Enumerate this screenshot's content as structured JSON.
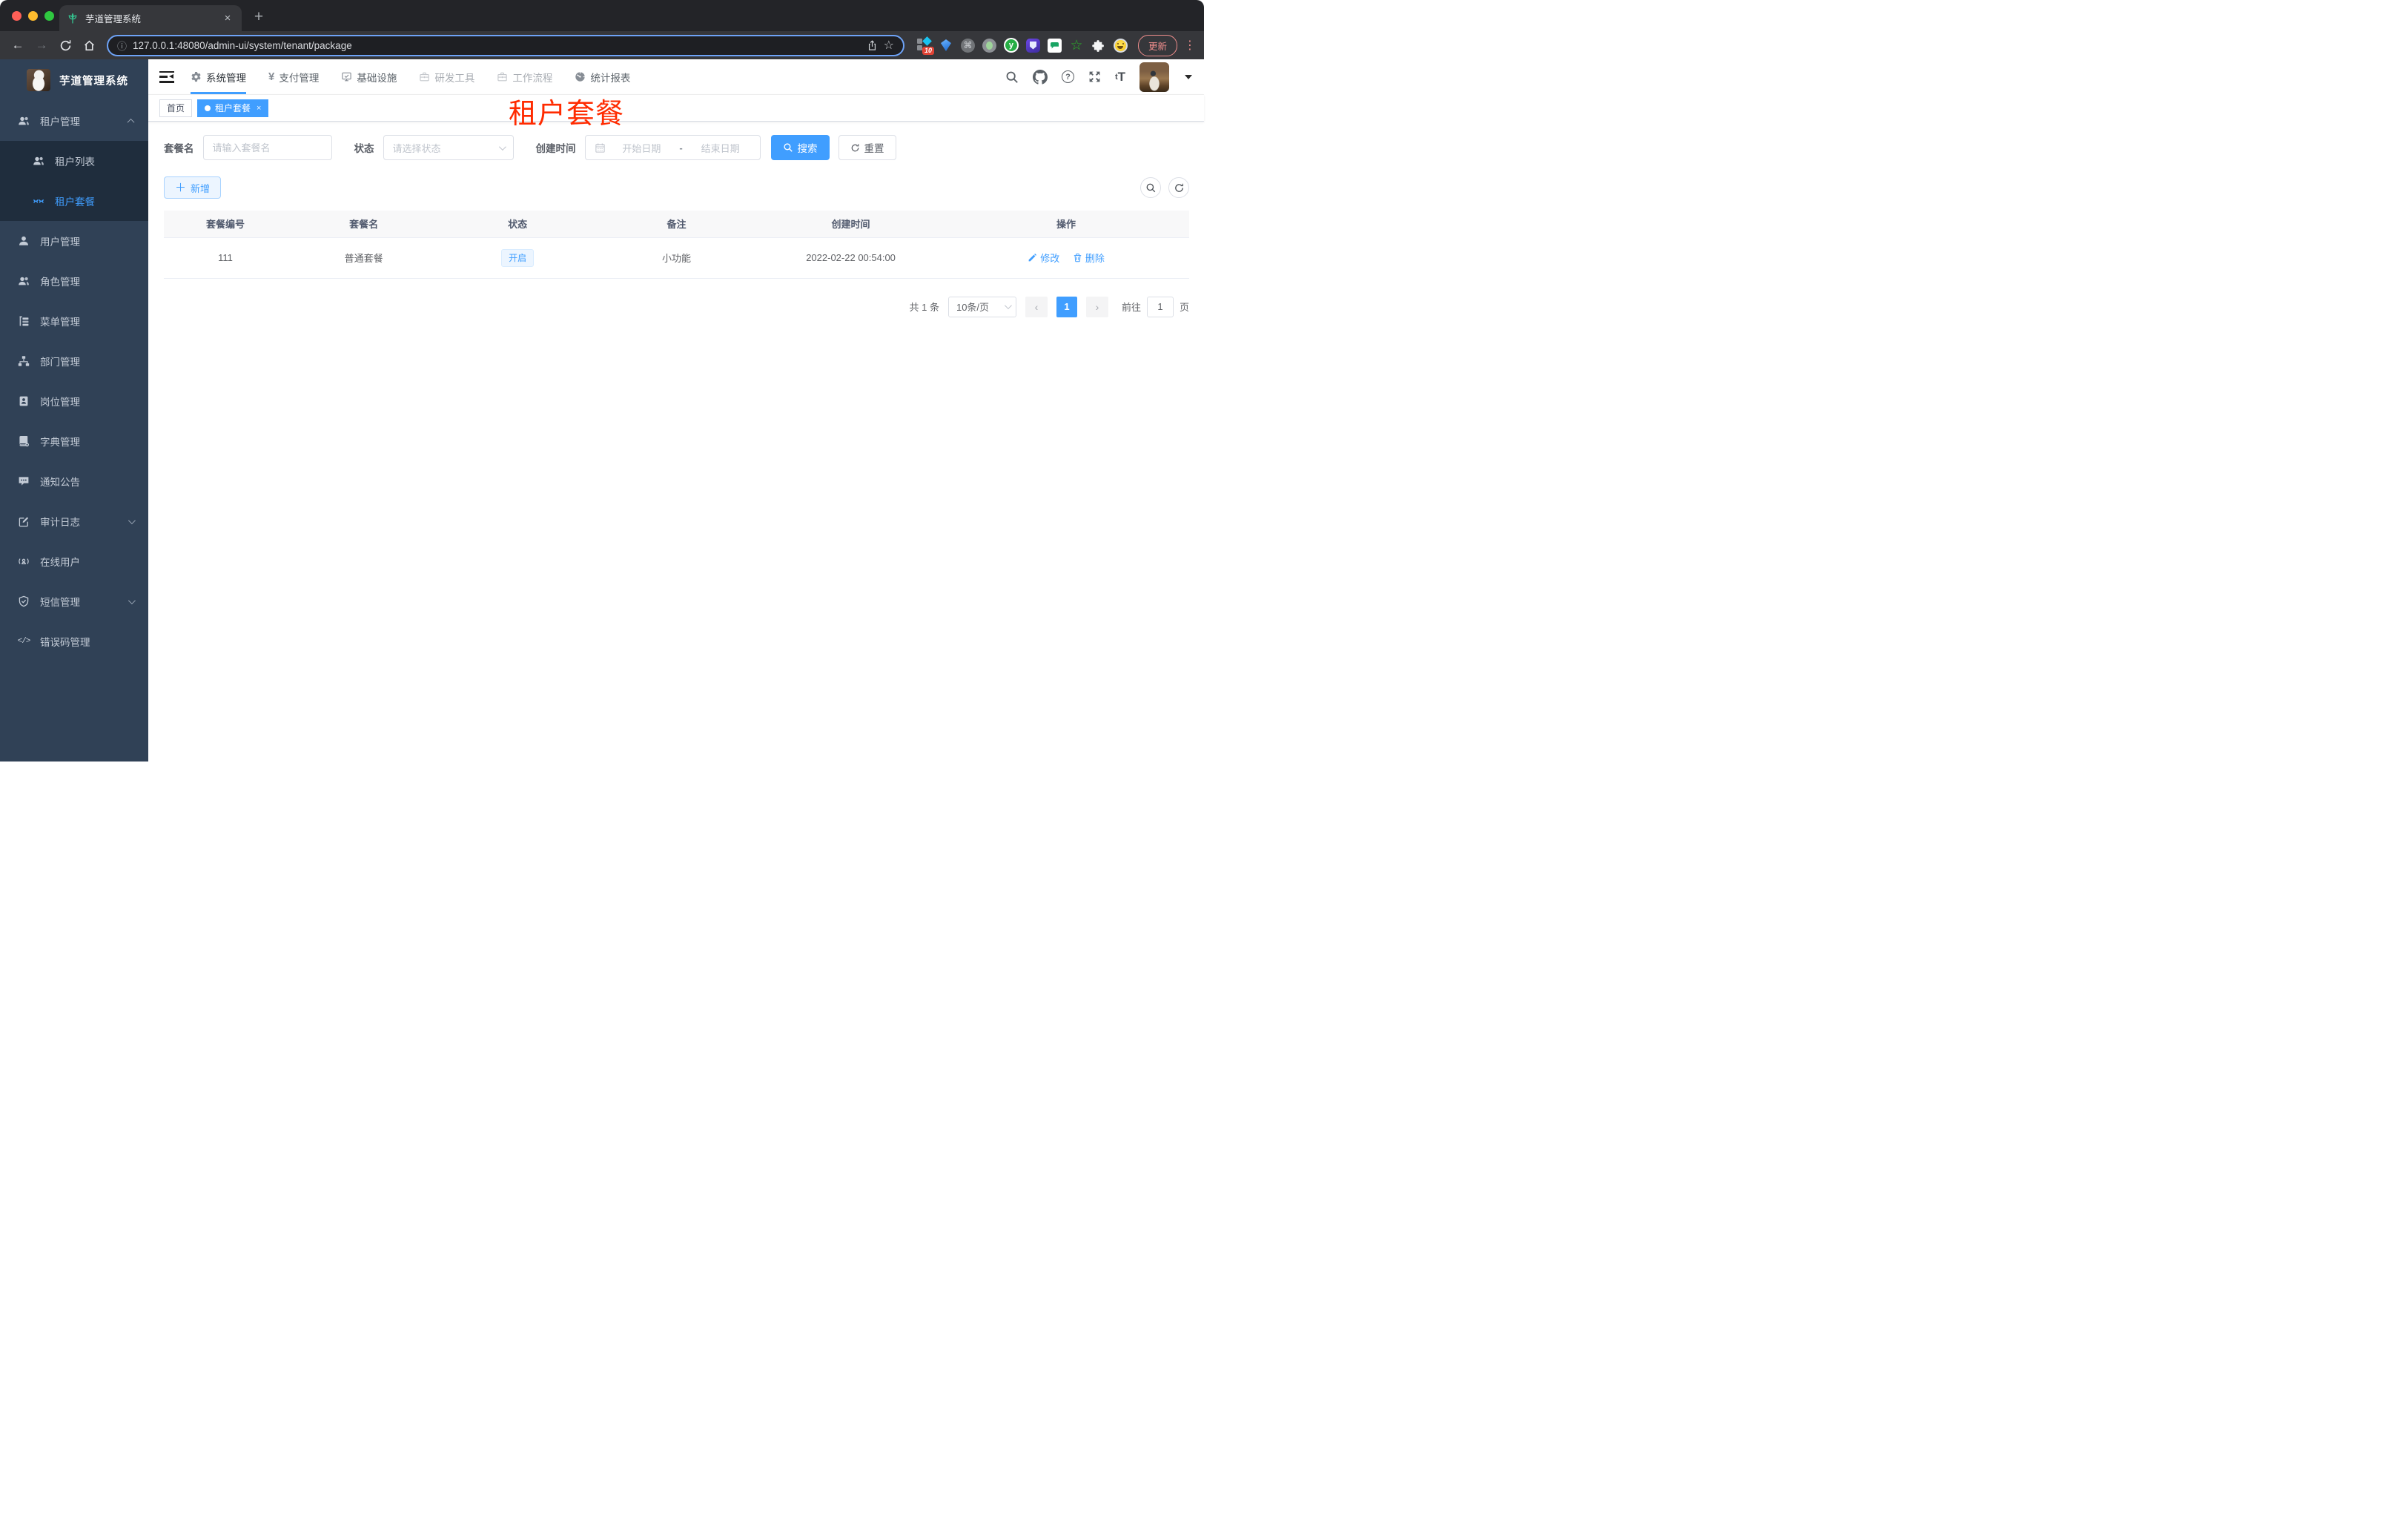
{
  "browser": {
    "tab_title": "芋道管理系统",
    "url": "127.0.0.1:48080/admin-ui/system/tenant/package",
    "update_label": "更新",
    "extension_badge": "10"
  },
  "app_header": {
    "title": "芋道管理系统"
  },
  "topnav": {
    "items": [
      {
        "label": "系统管理"
      },
      {
        "label": "支付管理"
      },
      {
        "label": "基础设施"
      },
      {
        "label": "研发工具"
      },
      {
        "label": "工作流程"
      },
      {
        "label": "统计报表"
      }
    ]
  },
  "sidebar": {
    "items": [
      {
        "label": "租户管理"
      },
      {
        "label": "租户列表"
      },
      {
        "label": "租户套餐"
      },
      {
        "label": "用户管理"
      },
      {
        "label": "角色管理"
      },
      {
        "label": "菜单管理"
      },
      {
        "label": "部门管理"
      },
      {
        "label": "岗位管理"
      },
      {
        "label": "字典管理"
      },
      {
        "label": "通知公告"
      },
      {
        "label": "审计日志"
      },
      {
        "label": "在线用户"
      },
      {
        "label": "短信管理"
      },
      {
        "label": "错误码管理"
      }
    ]
  },
  "tags": {
    "home": "首页",
    "active": "租户套餐"
  },
  "annotation": "租户套餐",
  "filters": {
    "name_label": "套餐名",
    "name_placeholder": "请输入套餐名",
    "status_label": "状态",
    "status_placeholder": "请选择状态",
    "date_label": "创建时间",
    "date_start_placeholder": "开始日期",
    "date_separator": "-",
    "date_end_placeholder": "结束日期",
    "search_label": "搜索",
    "reset_label": "重置"
  },
  "toolbar": {
    "add_label": "新增"
  },
  "table": {
    "headers": [
      "套餐编号",
      "套餐名",
      "状态",
      "备注",
      "创建时间",
      "操作"
    ],
    "rows": [
      {
        "id": "111",
        "name": "普通套餐",
        "status": "开启",
        "remark": "小功能",
        "created": "2022-02-22 00:54:00",
        "edit_label": "修改",
        "delete_label": "删除"
      }
    ]
  },
  "pagination": {
    "total": "共 1 条",
    "page_size": "10条/页",
    "page": "1",
    "goto_label": "前往",
    "goto_value": "1",
    "unit_label": "页"
  },
  "colors": {
    "primary": "#409eff",
    "sidebar_bg": "#304156",
    "submenu_bg": "#1f2d3d",
    "annotation_red": "#ff2b00",
    "status_tag_bg": "#ecf5ff"
  }
}
